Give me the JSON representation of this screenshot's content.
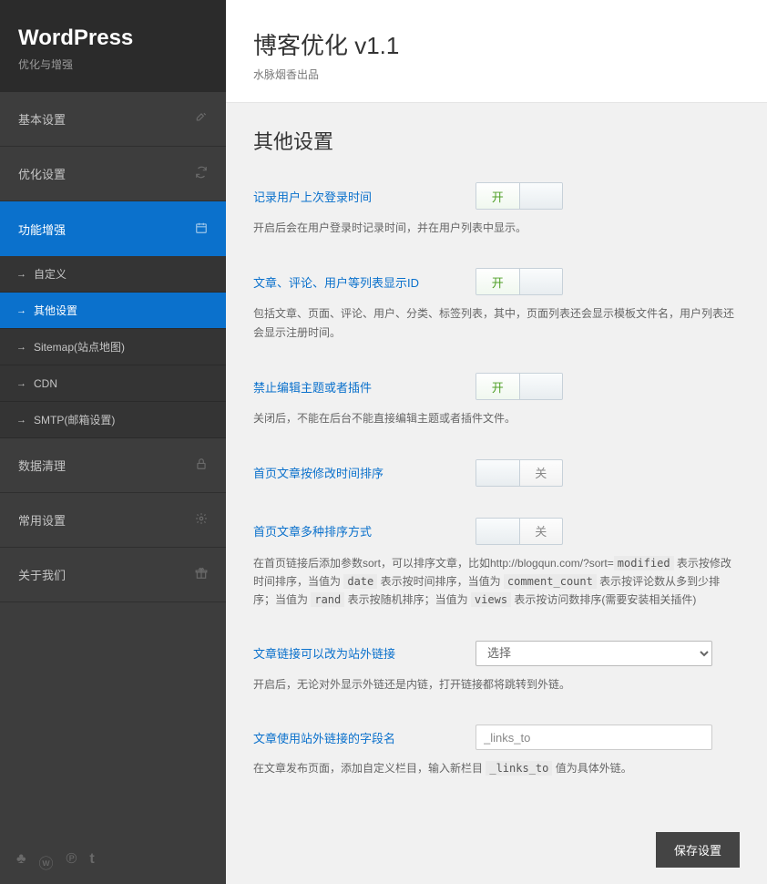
{
  "sidebar": {
    "title": "WordPress",
    "subtitle": "优化与增强",
    "menu": [
      {
        "label": "基本设置",
        "icon": "tools"
      },
      {
        "label": "优化设置",
        "icon": "refresh"
      },
      {
        "label": "功能增强",
        "icon": "calendar",
        "active": true
      },
      {
        "label": "数据清理",
        "icon": "lock"
      },
      {
        "label": "常用设置",
        "icon": "gear"
      },
      {
        "label": "关于我们",
        "icon": "gift"
      }
    ],
    "submenu": [
      {
        "label": "自定义"
      },
      {
        "label": "其他设置",
        "active": true
      },
      {
        "label": "Sitemap(站点地图)"
      },
      {
        "label": "CDN"
      },
      {
        "label": "SMTP(邮箱设置)"
      }
    ]
  },
  "header": {
    "title": "博客优化 v1.1",
    "subtitle": "水脉烟香出品"
  },
  "section_title": "其他设置",
  "toggle_text": {
    "on": "开",
    "off": "关"
  },
  "fields": {
    "login_time": {
      "label": "记录用户上次登录时间",
      "desc": "开启后会在用户登录时记录时间，并在用户列表中显示。",
      "state": "on"
    },
    "show_id": {
      "label": "文章、评论、用户等列表显示ID",
      "desc": "包括文章、页面、评论、用户、分类、标签列表，其中，页面列表还会显示模板文件名，用户列表还会显示注册时间。",
      "state": "on"
    },
    "disable_edit": {
      "label": "禁止编辑主题或者插件",
      "desc": "关闭后，不能在后台不能直接编辑主题或者插件文件。",
      "state": "on"
    },
    "sort_modified": {
      "label": "首页文章按修改时间排序",
      "state": "off"
    },
    "multi_sort": {
      "label": "首页文章多种排序方式",
      "desc_pre": "在首页链接后添加参数sort，可以排序文章，比如http://blogqun.com/?sort=",
      "code1": "modified",
      "desc_p1": " 表示按修改时间排序，当值为 ",
      "code2": "date",
      "desc_p2": " 表示按时间排序，当值为 ",
      "code3": "comment_count",
      "desc_p3": " 表示按评论数从多到少排序；当值为 ",
      "code4": "rand",
      "desc_p4": " 表示按随机排序；当值为 ",
      "code5": "views",
      "desc_p5": " 表示按访问数排序(需要安装相关插件)",
      "state": "off"
    },
    "ext_link": {
      "label": "文章链接可以改为站外链接",
      "select_placeholder": "选择",
      "desc": "开启后，无论对外显示外链还是内链，打开链接都将跳转到外链。"
    },
    "ext_field": {
      "label": "文章使用站外链接的字段名",
      "value": "_links_to",
      "desc_pre": "在文章发布页面，添加自定义栏目，输入新栏目 ",
      "code1": "_links_to",
      "desc_post": " 值为具体外链。"
    }
  },
  "save_button": "保存设置"
}
